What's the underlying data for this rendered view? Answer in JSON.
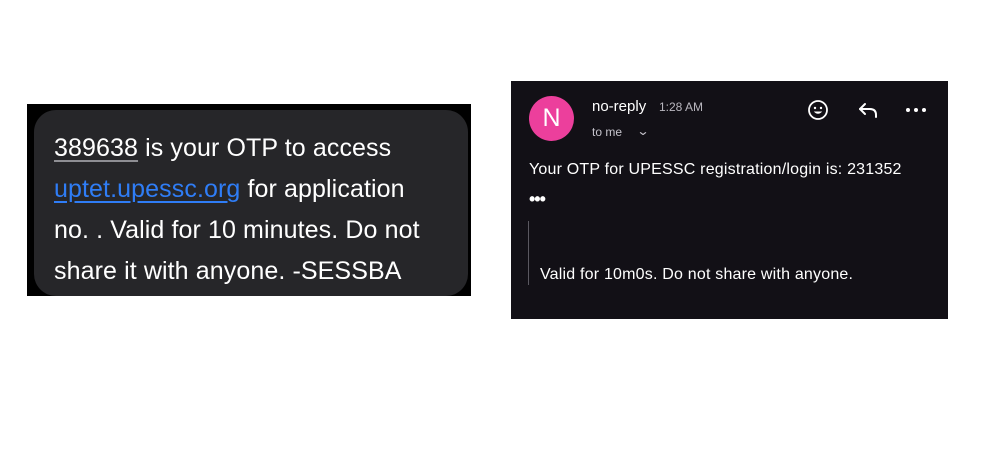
{
  "sms": {
    "otp": "389638",
    "line1_rest": " is your OTP to access",
    "link": "uptet.upessc.org",
    "line2_rest": " for application",
    "line3": "no. . Valid for 10 minutes. Do not",
    "line4": "share it with anyone. -SESSBA"
  },
  "email": {
    "avatar_letter": "N",
    "avatar_color": "#ec3f9c",
    "sender": "no-reply",
    "time": "1:28 AM",
    "recipient": "to me",
    "body": "Your OTP for UPESSC registration/login is: 231352",
    "ellipsis": "•••",
    "quoted": "Valid for 10m0s. Do not share with anyone.",
    "icons": [
      "emoji-icon",
      "reply-icon",
      "more-icon"
    ]
  }
}
